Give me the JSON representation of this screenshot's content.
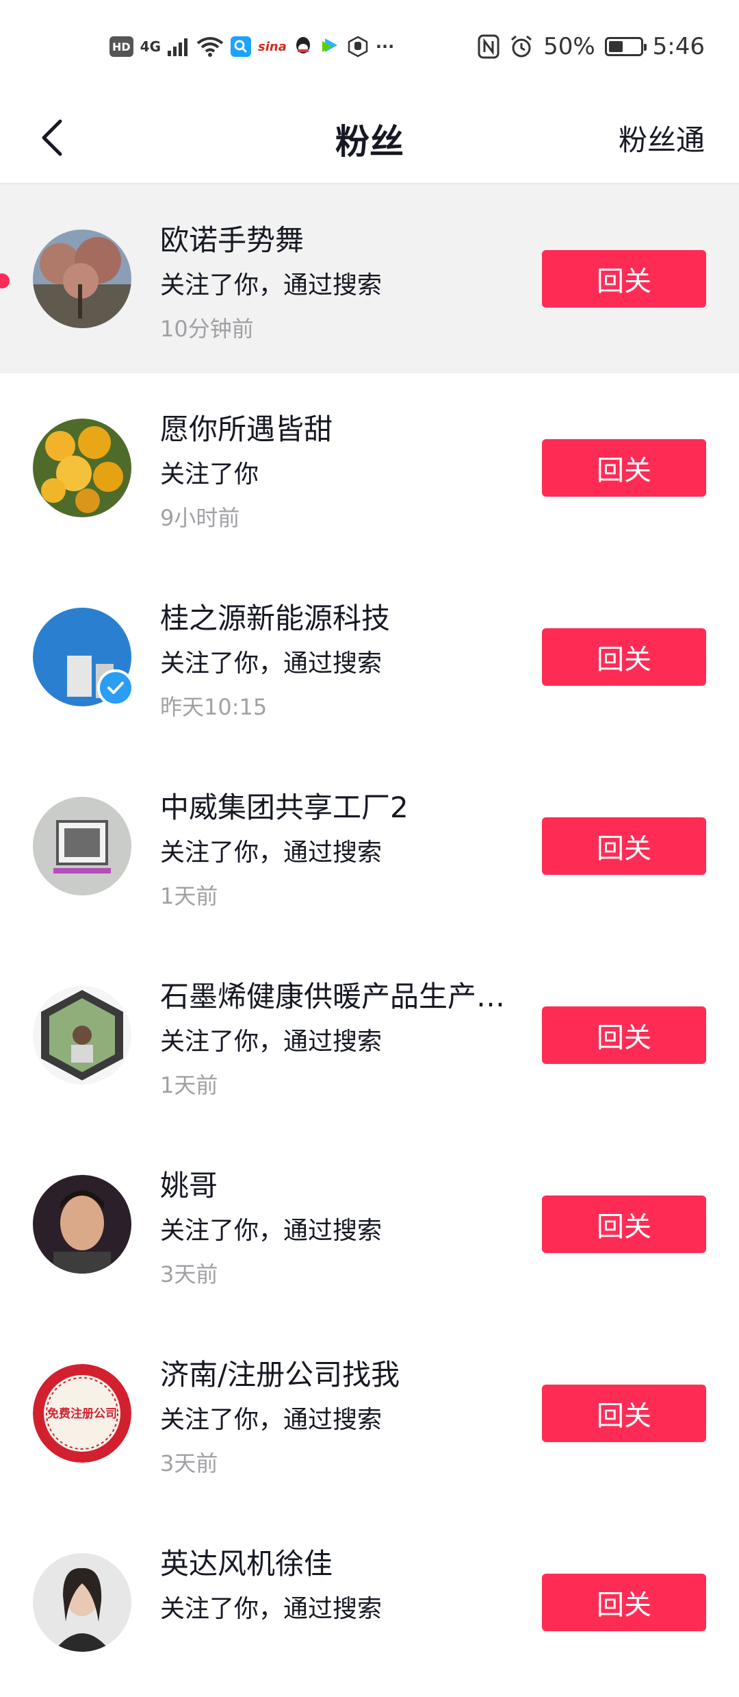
{
  "statusbar": {
    "left_icons": [
      "HD",
      "4G",
      "signal-icon",
      "wifi-icon",
      "search-app-icon",
      "sina-icon",
      "qq-icon",
      "video-app-icon",
      "hand-icon",
      "…"
    ],
    "hd": "HD",
    "net": "4G",
    "sina": "sina",
    "more": "···",
    "battery_pct": "50%",
    "time": "5:46"
  },
  "header": {
    "title": "粉丝",
    "right_label": "粉丝通"
  },
  "colors": {
    "accent": "#fe2c55",
    "time_gray": "#a0a0a5",
    "highlight_bg": "#f2f2f2"
  },
  "followers": [
    {
      "name": "欧诺手势舞",
      "desc": "关注了你，通过搜索",
      "time": "10分钟前",
      "button": "回关",
      "highlight": true,
      "unread": true
    },
    {
      "name": "愿你所遇皆甜",
      "desc": "关注了你",
      "time": "9小时前",
      "button": "回关"
    },
    {
      "name": "桂之源新能源科技",
      "desc": "关注了你，通过搜索",
      "time": "昨天10:15",
      "button": "回关",
      "verified": true
    },
    {
      "name": "中威集团共享工厂2",
      "desc": "关注了你，通过搜索",
      "time": "1天前",
      "button": "回关"
    },
    {
      "name": "石墨烯健康供暖产品生产…",
      "desc": "关注了你，通过搜索",
      "time": "1天前",
      "button": "回关"
    },
    {
      "name": "姚哥",
      "desc": "关注了你，通过搜索",
      "time": "3天前",
      "button": "回关"
    },
    {
      "name": "济南/注册公司找我",
      "desc": "关注了你，通过搜索",
      "time": "3天前",
      "button": "回关",
      "avatar_text": "免费注册公司"
    },
    {
      "name": "英达风机徐佳",
      "desc": "关注了你，通过搜索",
      "time": "",
      "button": "回关"
    }
  ]
}
